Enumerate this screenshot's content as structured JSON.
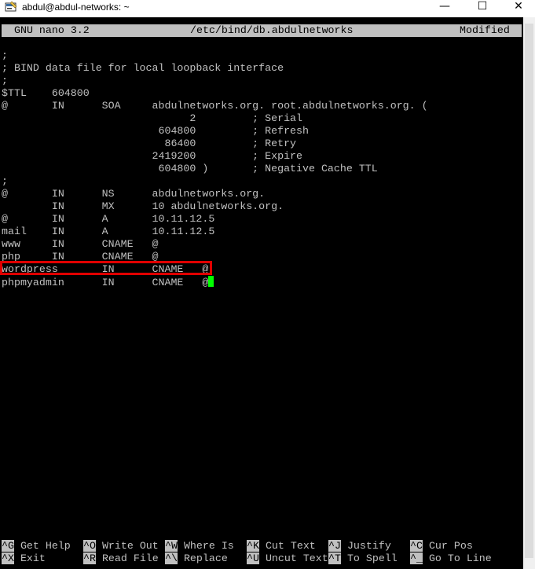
{
  "window": {
    "title": "abdul@abdul-networks: ~",
    "minimize_glyph": "—",
    "maximize_glyph": "☐",
    "close_glyph": "✕"
  },
  "nano_header": {
    "version": "GNU nano 3.2",
    "file_path": "/etc/bind/db.abdulnetworks",
    "status": "Modified"
  },
  "file_lines": [
    ";",
    "; BIND data file for local loopback interface",
    ";",
    "$TTL    604800",
    "@       IN      SOA     abdulnetworks.org. root.abdulnetworks.org. (",
    "                              2         ; Serial",
    "                         604800         ; Refresh",
    "                          86400         ; Retry",
    "                        2419200         ; Expire",
    "                         604800 )       ; Negative Cache TTL",
    ";",
    "@       IN      NS      abdulnetworks.org.",
    "        IN      MX      10 abdulnetworks.org.",
    "@       IN      A       10.11.12.5",
    "mail    IN      A       10.11.12.5",
    "www     IN      CNAME   @",
    "php     IN      CNAME   @",
    "wordpress       IN      CNAME   @",
    "phpmyadmin      IN      CNAME   @"
  ],
  "shortcuts_row1": [
    {
      "key": "^G",
      "label": " Get Help"
    },
    {
      "key": "^O",
      "label": " Write Out"
    },
    {
      "key": "^W",
      "label": " Where Is"
    },
    {
      "key": "^K",
      "label": " Cut Text"
    },
    {
      "key": "^J",
      "label": " Justify"
    },
    {
      "key": "^C",
      "label": " Cur Pos"
    }
  ],
  "shortcuts_row2": [
    {
      "key": "^X",
      "label": " Exit"
    },
    {
      "key": "^R",
      "label": " Read File"
    },
    {
      "key": "^\\",
      "label": " Replace"
    },
    {
      "key": "^U",
      "label": " Uncut Text"
    },
    {
      "key": "^T",
      "label": " To Spell"
    },
    {
      "key": "^_",
      "label": " Go To Line"
    }
  ],
  "colors": {
    "terminal_bg": "#000000",
    "terminal_fg": "#c0c0c0",
    "header_bg": "#c0c0c0",
    "cursor": "#00ff00",
    "highlight": "#e00000"
  },
  "icons": {
    "app": "terminal-app-icon",
    "minimize": "minimize-icon",
    "maximize": "maximize-icon",
    "close": "close-icon"
  }
}
